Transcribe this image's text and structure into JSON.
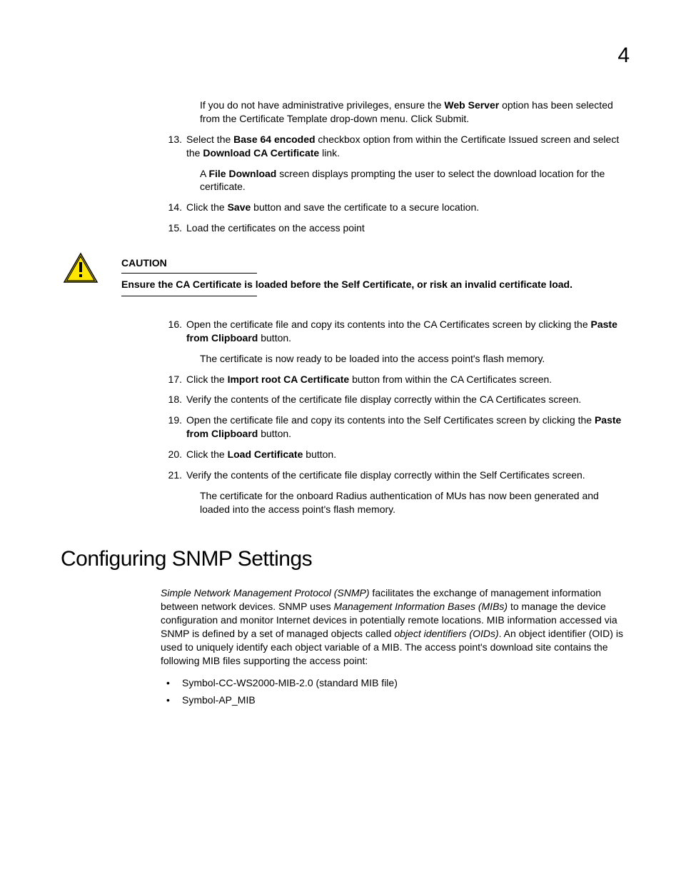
{
  "page_number": "4",
  "intro_sub": "If you do not have administrative privileges, ensure the {b}Web Server{/b} option has been selected from the Certificate Template drop-down menu. Click Submit.",
  "steps_a": [
    {
      "n": "13.",
      "t": "Select the {b}Base 64 encoded{/b} checkbox option from within the Certificate Issued screen and select the {b}Download CA Certificate{/b} link.",
      "sub": "A {b}File Download{/b} screen displays prompting the user to select the download location for the certificate."
    },
    {
      "n": "14.",
      "t": "Click the {b}Save{/b} button and save the certificate to a secure location."
    },
    {
      "n": "15.",
      "t": "Load the certificates on the access point"
    }
  ],
  "caution": {
    "label": "CAUTION",
    "text": "Ensure the CA Certificate is loaded before the Self Certificate, or risk an invalid certificate load."
  },
  "steps_b": [
    {
      "n": "16.",
      "t": "Open the certificate file and copy its contents into the CA Certificates screen by clicking the {b}Paste from Clipboard{/b} button.",
      "sub": "The certificate is now ready to be loaded into the access point's flash memory."
    },
    {
      "n": "17.",
      "t": "Click the {b}Import root CA Certificate{/b} button from within the CA Certificates screen."
    },
    {
      "n": "18.",
      "t": "Verify the contents of the certificate file display correctly within the CA Certificates screen."
    },
    {
      "n": "19.",
      "t": "Open the certificate file and copy its contents into the Self Certificates screen by clicking the {b}Paste from Clipboard{/b} button."
    },
    {
      "n": "20.",
      "t": "Click the {b}Load Certificate{/b} button."
    },
    {
      "n": "21.",
      "t": "Verify the contents of the certificate file display correctly within the Self Certificates screen.",
      "sub": "The certificate for the onboard Radius authentication of MUs has now been generated and loaded into the access point's flash memory."
    }
  ],
  "section_heading": "Configuring SNMP Settings",
  "section_para": "{i}Simple Network Management Protocol (SNMP){/i} facilitates the exchange of management information between network devices. SNMP uses {i}Management Information Bases (MIBs){/i} to manage the device configuration and monitor Internet devices in potentially remote locations. MIB information accessed via SNMP is defined by a set of managed objects called {i}object identifiers (OIDs){/i}. An object identifier (OID) is used to uniquely identify each object variable of a MIB. The access point's download site contains the following MIB files supporting the access point:",
  "bullets": [
    "Symbol-CC-WS2000-MIB-2.0 (standard MIB file)",
    "Symbol-AP_MIB"
  ]
}
